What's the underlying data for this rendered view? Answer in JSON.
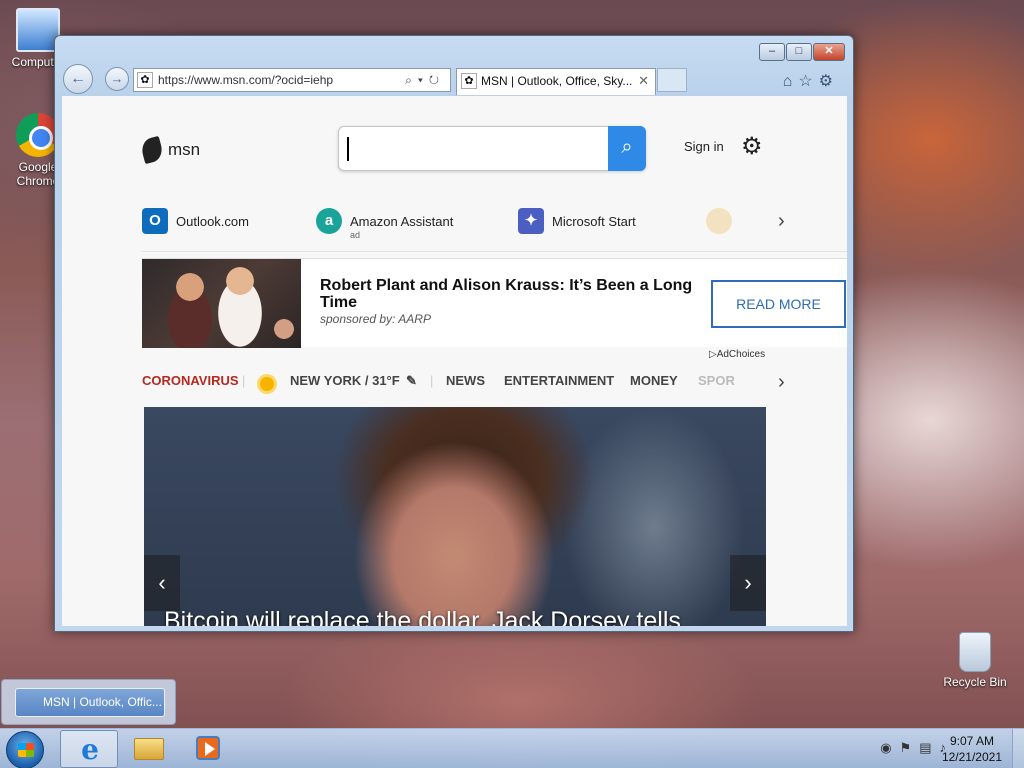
{
  "desktop": {
    "icons": [
      {
        "label": "Computer"
      },
      {
        "label": "Google Chrome"
      },
      {
        "label": "Recycle Bin"
      }
    ]
  },
  "browser": {
    "address_url": "https://www.msn.com/?ocid=iehp",
    "tab_title": "MSN | Outlook, Office, Sky...",
    "window_controls": {
      "minimize": "–",
      "maximize": "□",
      "close": "✕"
    }
  },
  "page": {
    "logo_text": "msn",
    "search": {
      "value": ""
    },
    "sign_in": "Sign in",
    "quick_links": [
      {
        "label": "Outlook.com",
        "icon": "outlook-icon",
        "color": "#0f6cbd",
        "sub": ""
      },
      {
        "label": "Amazon Assistant",
        "icon": "amazon-icon",
        "color": "#1aa399",
        "sub": "ad"
      },
      {
        "label": "Microsoft Start",
        "icon": "microsoft-start-icon",
        "color": "#4a5fc1",
        "sub": ""
      }
    ],
    "ad": {
      "title": "Robert Plant and Alison Krauss: It’s Been a Long Time",
      "sponsor": "sponsored by: AARP",
      "button": "READ MORE",
      "adchoices": "AdChoices"
    },
    "nav": {
      "coronavirus": "CORONAVIRUS",
      "weather": "NEW YORK / 31°F",
      "items": [
        "NEWS",
        "ENTERTAINMENT",
        "MONEY",
        "SPOR"
      ]
    },
    "hero_caption": "Bitcoin will replace the dollar, Jack Dorsey tells"
  },
  "taskbar": {
    "thumbnail_title": "MSN | Outlook, Offic...",
    "clock_time": "9:07 AM",
    "clock_date": "12/21/2021"
  },
  "colors": {
    "accent": "#2e8ae6",
    "coronavirus": "#b7281e",
    "ad_button": "#2f6cb4"
  }
}
